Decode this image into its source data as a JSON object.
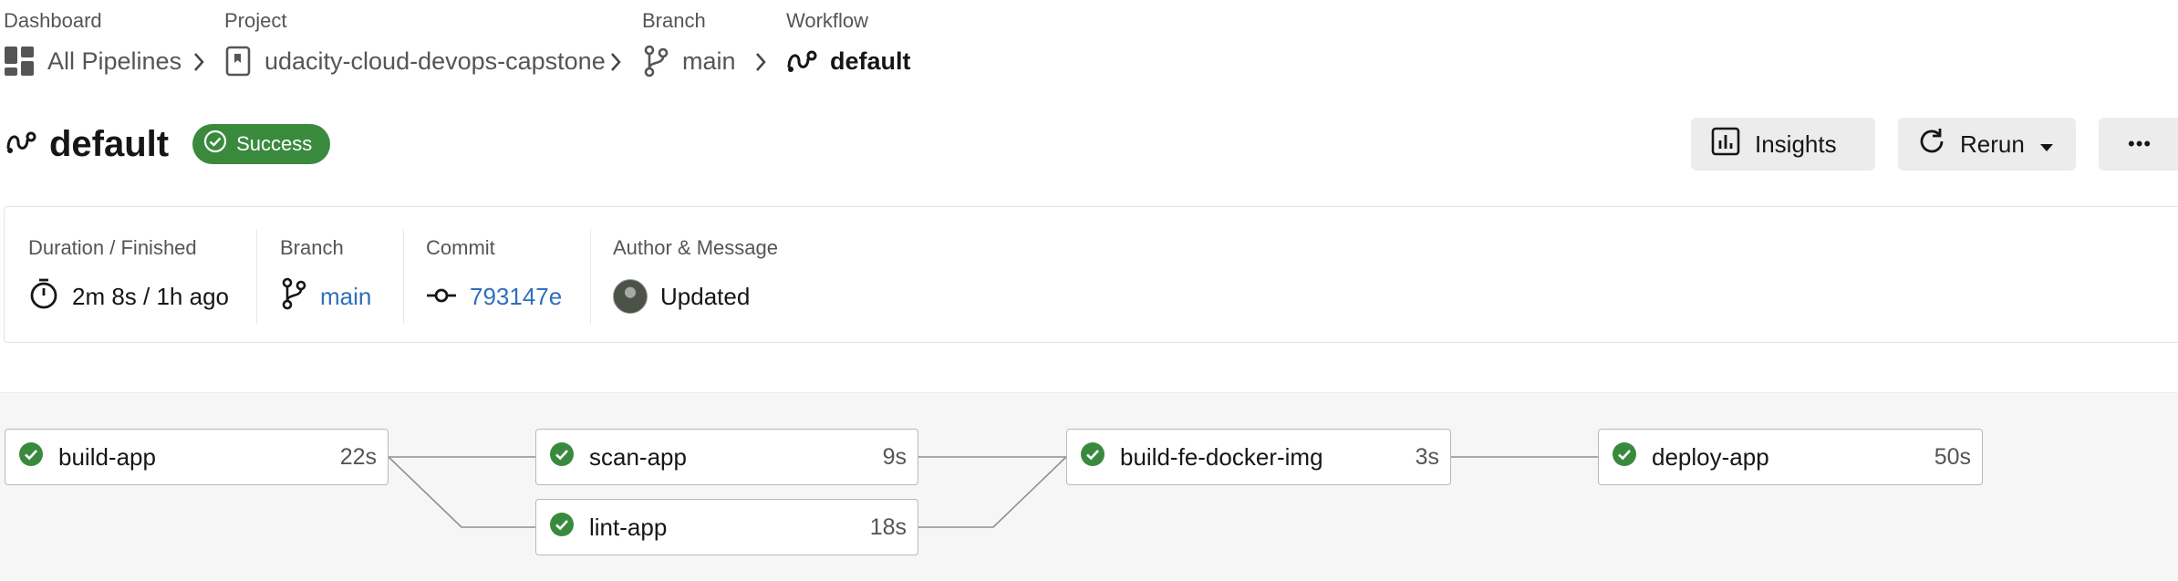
{
  "breadcrumb": {
    "dashboard": {
      "label": "Dashboard",
      "value": "All Pipelines"
    },
    "project": {
      "label": "Project",
      "value": "udacity-cloud-devops-capstone"
    },
    "branch": {
      "label": "Branch",
      "value": "main"
    },
    "workflow": {
      "label": "Workflow",
      "value": "default"
    }
  },
  "header": {
    "title": "default",
    "status": "Success",
    "status_color": "#3a8a3e",
    "insights_label": "Insights",
    "rerun_label": "Rerun",
    "more_label": "•••"
  },
  "summary": {
    "duration": {
      "label": "Duration / Finished",
      "value": "2m 8s / 1h ago"
    },
    "branch": {
      "label": "Branch",
      "value": "main"
    },
    "commit": {
      "label": "Commit",
      "value": "793147e"
    },
    "author": {
      "label": "Author & Message",
      "value": "Updated"
    }
  },
  "jobs": [
    {
      "name": "build-app",
      "duration": "22s",
      "status": "success"
    },
    {
      "name": "scan-app",
      "duration": "9s",
      "status": "success"
    },
    {
      "name": "lint-app",
      "duration": "18s",
      "status": "success"
    },
    {
      "name": "build-fe-docker-img",
      "duration": "3s",
      "status": "success"
    },
    {
      "name": "deploy-app",
      "duration": "50s",
      "status": "success"
    }
  ],
  "colors": {
    "accent_link": "#2f6fba",
    "success": "#3a8a3e"
  }
}
